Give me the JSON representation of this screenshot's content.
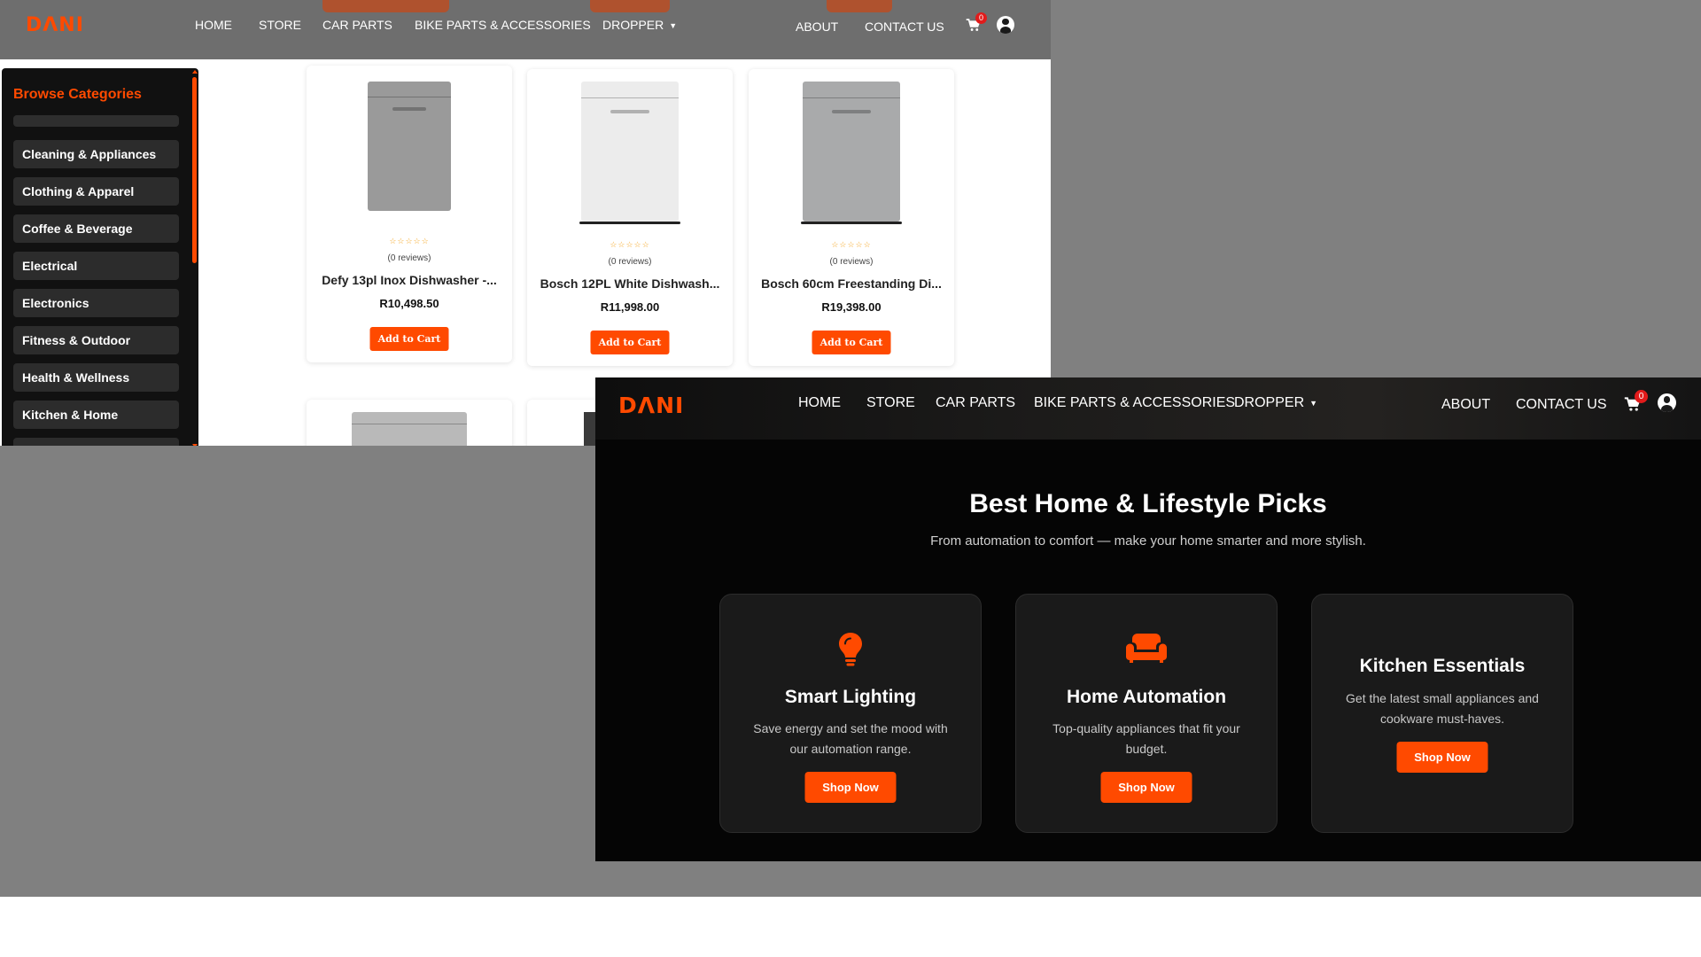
{
  "brand": {
    "logo": "DΛNI",
    "accent": "#ff4a00"
  },
  "store_window": {
    "nav": {
      "links": [
        "HOME",
        "STORE",
        "CAR PARTS",
        "BIKE PARTS & ACCESSORIES",
        "DROPPER"
      ],
      "right_links": [
        "ABOUT",
        "CONTACT US"
      ],
      "cart_count": "0"
    },
    "sidebar": {
      "title": "Browse Categories",
      "categories": [
        "Cleaning & Appliances",
        "Clothing & Apparel",
        "Coffee & Beverage",
        "Electrical",
        "Electronics",
        "Fitness & Outdoor",
        "Health & Wellness",
        "Kitchen & Home"
      ]
    },
    "products": [
      {
        "stars": "☆☆☆☆☆",
        "reviews": "(0 reviews)",
        "name": "Defy 13pl Inox Dishwasher -...",
        "price": "R10,498.50",
        "button": "Add to Cart",
        "color": "#9a9a9a"
      },
      {
        "stars": "☆☆☆☆☆",
        "reviews": "(0 reviews)",
        "name": "Bosch 12PL White Dishwash...",
        "price": "R11,998.00",
        "button": "Add to Cart",
        "color": "#ececec"
      },
      {
        "stars": "☆☆☆☆☆",
        "reviews": "(0 reviews)",
        "name": "Bosch 60cm Freestanding Di...",
        "price": "R19,398.00",
        "button": "Add to Cart",
        "color": "#a9aaab"
      }
    ]
  },
  "home_window": {
    "nav": {
      "links": [
        "HOME",
        "STORE",
        "CAR PARTS",
        "BIKE PARTS & ACCESSORIES",
        "DROPPER"
      ],
      "right_links": [
        "ABOUT",
        "CONTACT US"
      ],
      "cart_count": "0"
    },
    "hero": {
      "title": "Best Home & Lifestyle Picks",
      "subtitle": "From automation to comfort — make your home smarter and more stylish."
    },
    "features": [
      {
        "icon": "lightbulb-icon",
        "title": "Smart Lighting",
        "desc": "Save energy and set the mood with our automation range.",
        "button": "Shop Now"
      },
      {
        "icon": "couch-icon",
        "title": "Home Automation",
        "desc": "Top-quality appliances that fit your budget.",
        "button": "Shop Now"
      },
      {
        "icon": "",
        "title": "Kitchen Essentials",
        "desc": "Get the latest small appliances and cookware must-haves.",
        "button": "Shop Now"
      }
    ]
  }
}
